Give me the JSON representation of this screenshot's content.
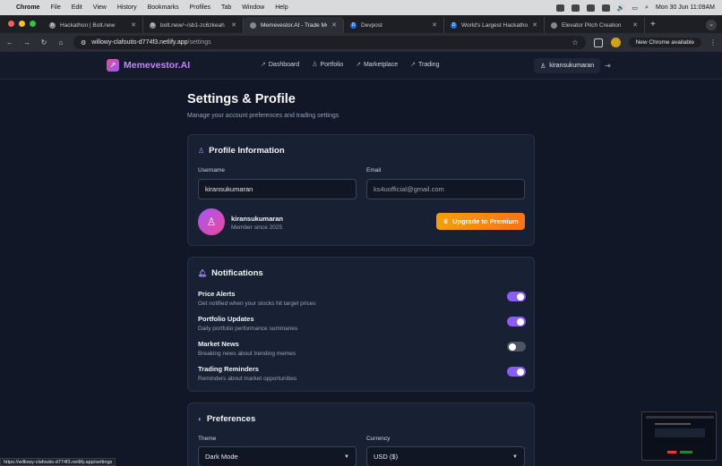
{
  "menubar": {
    "app": "Chrome",
    "items": [
      "File",
      "Edit",
      "View",
      "History",
      "Bookmarks",
      "Profiles",
      "Tab",
      "Window",
      "Help"
    ],
    "clock": "Mon 30 Jun  11:09AM"
  },
  "tabs": [
    {
      "title": "Hackathon | Bolt.new",
      "icon": "b"
    },
    {
      "title": "bolt.new/~/sb1-zc6zkeah",
      "icon": "b"
    },
    {
      "title": "Memevestor.AI - Trade Meme",
      "icon": "globe"
    },
    {
      "title": "Devpost",
      "icon": "D"
    },
    {
      "title": "World's Largest Hackathon p",
      "icon": "D"
    },
    {
      "title": "Elevator Pitch Creation",
      "icon": "globe"
    }
  ],
  "toolbar": {
    "url_host": "willowy-clafoutis-d774f3.netlify.app",
    "url_path": "/settings",
    "new_chrome": "New Chrome available"
  },
  "app": {
    "name": "Memevestor.AI",
    "nav": [
      "Dashboard",
      "Portfolio",
      "Marketplace",
      "Trading"
    ],
    "user": "kiransukumaran"
  },
  "page": {
    "title": "Settings & Profile",
    "subtitle": "Manage your account preferences and trading settings"
  },
  "profile": {
    "title": "Profile Information",
    "username_label": "Username",
    "username_value": "kiransukumaran",
    "email_label": "Email",
    "email_placeholder": "ks4uofficial@gmail.com",
    "display_name": "kiransukumaran",
    "member_since": "Member since 2025",
    "upgrade_label": "Upgrade to Premium"
  },
  "notifications": {
    "title": "Notifications",
    "items": [
      {
        "title": "Price Alerts",
        "desc": "Get notified when your stocks hit target prices",
        "enabled": true
      },
      {
        "title": "Portfolio Updates",
        "desc": "Daily portfolio performance summaries",
        "enabled": true
      },
      {
        "title": "Market News",
        "desc": "Breaking news about trending memes",
        "enabled": false
      },
      {
        "title": "Trading Reminders",
        "desc": "Reminders about market opportunities",
        "enabled": true
      }
    ]
  },
  "preferences": {
    "title": "Preferences",
    "theme_label": "Theme",
    "theme_value": "Dark Mode",
    "currency_label": "Currency",
    "currency_value": "USD ($)"
  },
  "status_url": "https://willowy-clafoutis-d774f3.netlify.app/settings",
  "colors": {
    "accent": "#8b5cf6",
    "premium": "#f59e0b",
    "background": "#111726"
  }
}
